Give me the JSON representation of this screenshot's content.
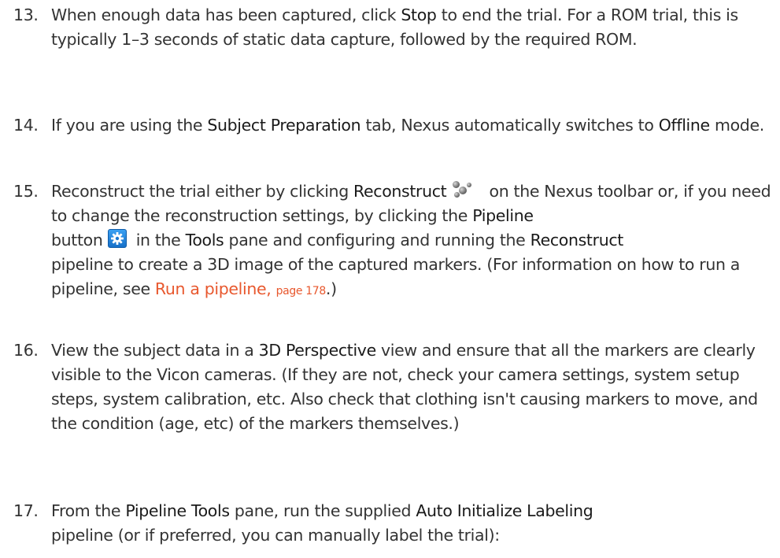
{
  "steps": [
    {
      "number": "13.",
      "parts": [
        "When enough data has been captured, click ",
        "Stop",
        " to end the trial. For a ROM trial, this is typically 1–3 seconds of static data capture, followed by the required ROM."
      ]
    },
    {
      "number": "14.",
      "parts": [
        "If you are using the ",
        "Subject Preparation",
        " tab, Nexus automatically switches to ",
        "Offline",
        " mode."
      ]
    },
    {
      "number": "15.",
      "parts": [
        "Reconstruct the trial either by clicking ",
        "Reconstruct",
        " on the Nexus toolbar or, if you need to change the reconstruction settings, by clicking the ",
        "Pipeline",
        "button",
        " in the ",
        "Tools",
        " pane and configuring and running the ",
        "Reconstruct",
        "pipeline to create a 3D image of the captured markers. (For information on how to run a pipeline, see ",
        "Run a pipeline,",
        "page 178",
        ".)"
      ],
      "icons": [
        "reconstruct-icon",
        "gear-icon"
      ]
    },
    {
      "number": "16.",
      "parts": [
        "View the subject data in a ",
        "3D Perspective",
        " view and ensure that all the markers are clearly visible to the Vicon cameras. (If they are not, check your camera settings, system setup steps, system calibration, etc. Also check that clothing isn't causing markers to move, and the condition (age, etc) of the markers themselves.)"
      ]
    },
    {
      "number": "17.",
      "parts": [
        "From the ",
        "Pipeline Tools",
        " pane, run the supplied ",
        "Auto Initialize Labeling",
        "pipeline (or if preferred, you can manually label the trial):"
      ]
    }
  ],
  "colors": {
    "body_text": "#333333",
    "ui_term": "#1a1a1a",
    "link": "#e8582e",
    "icon_blue": "#1670c9"
  }
}
